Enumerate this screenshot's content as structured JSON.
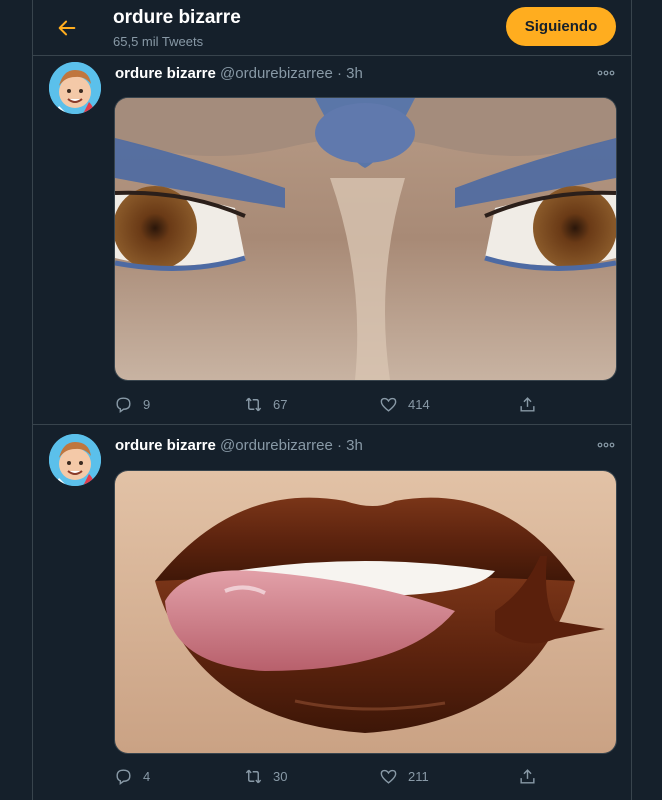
{
  "header": {
    "title": "ordure bizarre",
    "tweet_count": "65,5 mil Tweets",
    "follow_label": "Siguiendo",
    "accent_color": "#ffad1f"
  },
  "tweets": [
    {
      "name": "ordure bizarre",
      "handle": "@ordurebizarree",
      "separator": "·",
      "time": "3h",
      "media": "close-up of eyes with blue eyeshadow and a blue nose bridge ornament",
      "replies": "9",
      "retweets": "67",
      "likes": "414"
    },
    {
      "name": "ordure bizarre",
      "handle": "@ordurebizarree",
      "separator": "·",
      "time": "3h",
      "media": "close-up of glossy brown lips with tongue and a snail",
      "replies": "4",
      "retweets": "30",
      "likes": "211"
    }
  ],
  "icons": [
    "back-arrow-icon",
    "more-icon",
    "reply-icon",
    "retweet-icon",
    "like-icon",
    "share-icon"
  ]
}
